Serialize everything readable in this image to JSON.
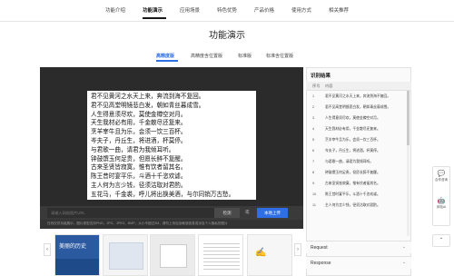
{
  "topnav": {
    "items": [
      "功能介绍",
      "功能演示",
      "应用场景",
      "特色优势",
      "产品价格",
      "使用方式",
      "相关推荐"
    ],
    "active_index": 1
  },
  "page": {
    "title": "功能演示"
  },
  "subtabs": {
    "items": [
      "高精度版",
      "高精度含位置版",
      "标准版",
      "标准含位置版"
    ],
    "active_index": 0
  },
  "document": {
    "lines": [
      "君不见黄河之水天上来，奔流到海不复回。",
      "君不见高堂明镜悲白发，朝如青丝暮成雪。",
      "人生得意须尽欢，莫使金樽空对月。",
      "天生我材必有用，千金散尽还复来。",
      "烹羊宰牛且为乐，会须一饮三百杯。",
      "岑夫子，丹丘生，将进酒，杯莫停。",
      "与君歌一曲，请君为我倾耳听。",
      "钟鼓馔玉何足贵，但愿长醉不复醒。",
      "古来圣贤皆寂寞，惟有饮者留其名。",
      "陈王昔时宴平乐，斗酒十千恣欢谑。",
      "主人何为言少钱，径须沽取对君酌。",
      "五花马，千金裘，呼儿将出换美酒，与尔同销万古愁。"
    ]
  },
  "upload": {
    "url_placeholder": "请输入网络图片URL",
    "detect_label": "检测",
    "or_label": "或",
    "upload_label": "本地上传",
    "hint": "在线仅供功能展示，图片类型支持PNG、JPG、JPEG、BMP，大小不超过3M，请勿上传包含敏感信息或涉及个人隐私的图片"
  },
  "thumbnails": {
    "t1_text": "美丽的历史"
  },
  "side": {
    "title": "识别结果",
    "col_no": "序号",
    "col_text": "内容",
    "rows": [
      {
        "no": "1",
        "text": "君不见黄河之水天上来，奔流到海不复回。"
      },
      {
        "no": "2",
        "text": "君不见高堂明镜悲白发，朝如青丝暮成雪。"
      },
      {
        "no": "3",
        "text": "人生得意须尽欢，莫使金樽空对月。"
      },
      {
        "no": "4",
        "text": "天生我材必有用，千金散尽还复来。"
      },
      {
        "no": "5",
        "text": "烹羊宰牛且为乐，会须一饮三百杯。"
      },
      {
        "no": "6",
        "text": "岑夫子，丹丘生，将进酒，杯莫停。"
      },
      {
        "no": "7",
        "text": "与君歌一曲，请君为我倾耳听。"
      },
      {
        "no": "8",
        "text": "钟鼓馔玉何足贵，但愿长醉不复醒。"
      },
      {
        "no": "9",
        "text": "古来圣贤皆寂寞，惟有饮者留其名。"
      },
      {
        "no": "10",
        "text": "陈王昔时宴平乐，斗酒十千恣欢谑。"
      },
      {
        "no": "11",
        "text": "主人何为言少钱，径须沽取对君酌。"
      }
    ],
    "request_label": "Request",
    "response_label": "Response"
  },
  "float": {
    "consult_label": "合作咨询",
    "feedback_label": "体验AI",
    "top_label": "返回顶部"
  },
  "colors": {
    "accent": "#2f6fe4",
    "panel": "#2b2b2b"
  }
}
